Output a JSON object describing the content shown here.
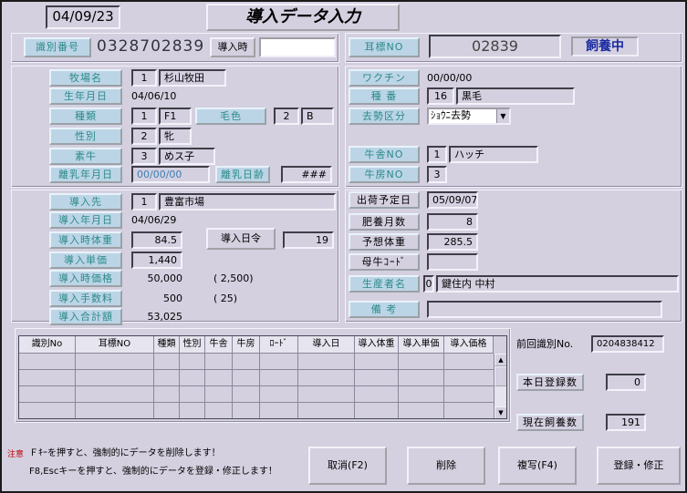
{
  "header": {
    "date": "04/09/23",
    "title": "導入データ入力",
    "id_label": "識別番号",
    "id_value": "0328702839",
    "intro_label": "導入時",
    "intro_value": "",
    "ear_label": "耳標NO",
    "ear_value": "02839",
    "status": "飼養中"
  },
  "cattle": {
    "breed_label": "牧場名",
    "breed_code": "1",
    "breed_name": "杉山牧田",
    "birth_label": "生年月日",
    "birth_value": "04/06/10",
    "type_label": "種類",
    "type_code": "1",
    "type_name": "F1",
    "color_label": "毛色",
    "color_code": "2",
    "color_name": "B",
    "sex_label": "性別",
    "sex_code": "2",
    "sex_name": "牝",
    "dam_label": "素牛",
    "dam_code": "3",
    "dam_name": "めス子",
    "wean_label": "離乳年月日",
    "wean_value": "00/00/00",
    "wean_day_label": "離乳日齢",
    "wean_day_value": "###"
  },
  "vaccine": {
    "vaccine_label": "ワクチン",
    "vaccine_value": "00/00/00",
    "kind_label": "種 番",
    "kind_code": "16",
    "kind_name": "黒毛",
    "cause_label": "去勢区分",
    "cause_value": "ｼｮｳﾆ去勢",
    "barn_label": "牛舎NO",
    "barn_code": "1",
    "barn_name": "ハッチ",
    "room_label": "牛房NO",
    "room_value": "3"
  },
  "purchase": {
    "source_label": "導入先",
    "source_code": "1",
    "source_name": "豊富市場",
    "date_label": "導入年月日",
    "date_value": "04/06/29",
    "weight_label": "導入時体重",
    "weight_value": "84.5",
    "days_btn": "導入日令",
    "days_value": "19",
    "unit_label": "導入単価",
    "unit_value": "1,440",
    "price_label": "導入時価格",
    "price_value": "50,000",
    "price_note": "( 2,500)",
    "fee_label": "導入手数料",
    "fee_value": "500",
    "fee_note": "( 25)",
    "total_label": "導入合計額",
    "total_value": "53,025"
  },
  "shipping": {
    "plan_label": "出荷予定日",
    "plan_value": "05/09/07",
    "months_label": "肥養月数",
    "months_value": "8",
    "weight_label": "予想体重",
    "weight_value": "285.5",
    "father_label": "母牛ｺｰﾄﾞ",
    "father_value": "",
    "producer_label": "生産者名",
    "producer_code": "0",
    "producer_name": "鍵住内 中村",
    "note_label": "備 考",
    "note_value": ""
  },
  "grid": {
    "columns": [
      "識別No",
      "耳標NO",
      "種類",
      "性別",
      "牛舎",
      "牛房",
      "ﾛｰﾄﾞ",
      "導入日",
      "導入体重",
      "導入単価",
      "導入価格"
    ],
    "rows": 5
  },
  "stats": {
    "prev_label": "前回識別No.",
    "prev_value": "0204838412",
    "today_label": "本日登録数",
    "today_value": "0",
    "current_label": "現在飼養数",
    "current_value": "191"
  },
  "footer": {
    "note_title": "注意",
    "note_line1": "Ｆｷｰを押すと、強制的にデータを削除します！",
    "note_line2": "F8,Escキーを押すと、強制的にデータを登録・修正します！",
    "cancel_btn": "取消(F2)",
    "delete_btn": "削除",
    "copy_btn": "複写(F4)",
    "save_btn": "登録・修正"
  },
  "colors": {
    "window_bg": "#d4d0e0",
    "label_bg": "#bcd5e6",
    "label_text": "#2a8a8a",
    "status_text": "#1a2aa0"
  }
}
